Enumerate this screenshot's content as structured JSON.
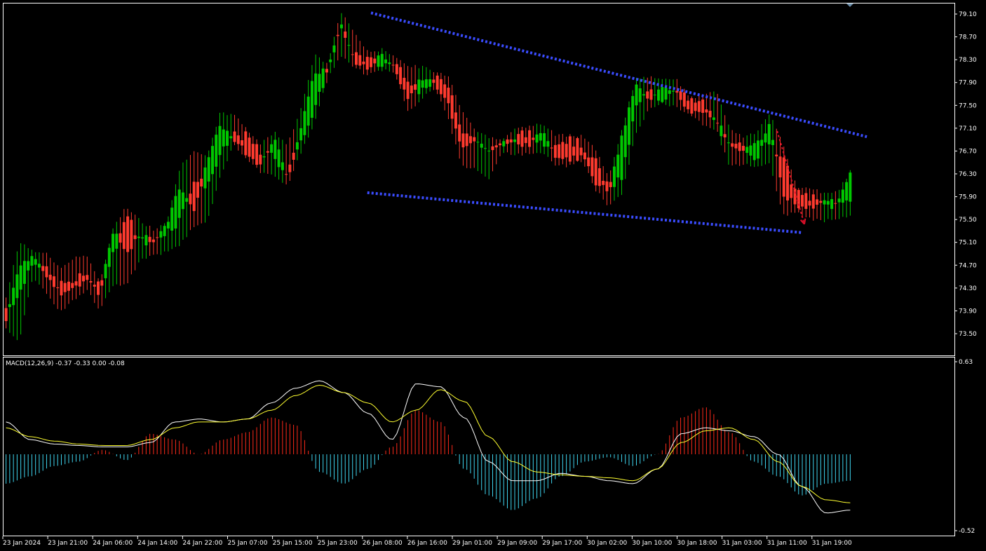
{
  "indicator": {
    "label": "MACD(12,26,9) -0.37 -0.33 0.00 -0.08",
    "params": [
      12,
      26,
      9
    ],
    "values": [
      -0.37,
      -0.33,
      0.0,
      -0.08
    ]
  },
  "colors": {
    "background": "#000000",
    "frame": "#ffffff",
    "bull_candle": "#00c800",
    "bear_candle": "#ff3b2f",
    "trendline": "#3a4cff",
    "forecast_arrow": "#e0102a",
    "macd_hist_pos": "#ff2a1a",
    "macd_hist_neg": "#3fd6f0",
    "macd_line": "#ffffff",
    "signal_line": "#ffff30"
  },
  "chart_data": [
    {
      "type": "candlestick",
      "price_axis_ticks": [
        "79.10",
        "78.70",
        "78.30",
        "77.90",
        "77.50",
        "77.10",
        "76.70",
        "76.30",
        "75.90",
        "75.50",
        "75.10",
        "74.70",
        "74.30",
        "73.90",
        "73.50"
      ],
      "ylim": [
        73.2,
        79.25
      ],
      "time_axis_ticks": [
        "23 Jan 2024",
        "23 Jan 21:00",
        "24 Jan 06:00",
        "24 Jan 14:00",
        "24 Jan 22:00",
        "25 Jan 07:00",
        "25 Jan 15:00",
        "25 Jan 23:00",
        "26 Jan 08:00",
        "26 Jan 16:00",
        "29 Jan 01:00",
        "29 Jan 09:00",
        "29 Jan 17:00",
        "30 Jan 02:00",
        "30 Jan 10:00",
        "30 Jan 18:00",
        "31 Jan 03:00",
        "31 Jan 11:00",
        "31 Jan 19:00"
      ],
      "trendlines": [
        {
          "from": {
            "bar": 99,
            "price": 79.12
          },
          "to": {
            "bar": 224,
            "price": 76.95
          }
        },
        {
          "from": {
            "bar": 98,
            "price": 75.97
          },
          "to": {
            "bar": 216,
            "price": 75.27
          }
        }
      ],
      "forecast_arrow": {
        "from": {
          "bar": 205,
          "price": 77.05
        },
        "to": {
          "bar": 212,
          "price": 75.42
        }
      },
      "ohlc_key_points": [
        [
          73.95,
          74.1,
          73.6,
          73.72
        ],
        [
          74.18,
          75.1,
          73.4,
          74.7
        ],
        [
          74.82,
          74.9,
          74.55,
          74.82
        ],
        [
          74.6,
          74.9,
          74.22,
          74.55
        ],
        [
          74.35,
          74.6,
          73.9,
          74.2
        ],
        [
          74.4,
          74.8,
          74.1,
          74.3
        ],
        [
          74.55,
          74.85,
          74.3,
          74.45
        ],
        [
          74.3,
          74.35,
          73.95,
          74.2
        ],
        [
          74.9,
          75.35,
          74.4,
          75.3
        ],
        [
          75.6,
          75.7,
          74.4,
          74.9
        ],
        [
          75.1,
          75.45,
          74.8,
          75.25
        ],
        [
          75.15,
          75.3,
          74.9,
          75.1
        ],
        [
          75.3,
          75.45,
          74.95,
          75.4
        ],
        [
          75.5,
          76.4,
          75.1,
          76.1
        ],
        [
          76.2,
          76.7,
          75.4,
          75.6
        ],
        [
          76.1,
          76.55,
          75.5,
          76.5
        ],
        [
          76.6,
          77.35,
          76.3,
          77.2
        ],
        [
          77.0,
          77.3,
          76.85,
          76.9
        ],
        [
          76.95,
          77.05,
          76.55,
          76.65
        ],
        [
          76.65,
          76.8,
          76.35,
          76.45
        ],
        [
          76.6,
          77.0,
          76.3,
          76.95
        ],
        [
          76.3,
          76.8,
          76.1,
          76.2
        ],
        [
          76.95,
          77.4,
          76.7,
          77.05
        ],
        [
          77.35,
          78.35,
          77.2,
          78.1
        ],
        [
          78.15,
          78.2,
          78.0,
          78.1
        ],
        [
          78.85,
          79.12,
          78.4,
          78.95
        ],
        [
          78.4,
          78.75,
          78.2,
          78.25
        ],
        [
          78.3,
          78.4,
          78.05,
          78.15
        ],
        [
          78.2,
          78.45,
          78.15,
          78.4
        ],
        [
          78.25,
          78.35,
          78.1,
          78.15
        ],
        [
          78.0,
          78.15,
          77.4,
          77.55
        ],
        [
          77.7,
          78.15,
          77.65,
          78.0
        ],
        [
          77.95,
          78.05,
          77.8,
          77.9
        ],
        [
          77.9,
          78.0,
          77.3,
          77.5
        ],
        [
          77.1,
          77.4,
          76.45,
          76.7
        ],
        [
          76.9,
          77.05,
          76.45,
          76.9
        ],
        [
          76.7,
          76.9,
          76.2,
          76.7
        ],
        [
          76.8,
          76.9,
          76.7,
          76.85
        ],
        [
          76.95,
          77.05,
          76.65,
          76.85
        ],
        [
          77.0,
          77.1,
          76.7,
          76.8
        ],
        [
          76.85,
          77.15,
          76.7,
          77.05
        ],
        [
          76.85,
          76.95,
          76.5,
          76.55
        ],
        [
          76.9,
          76.95,
          76.45,
          76.55
        ],
        [
          76.8,
          76.95,
          76.55,
          76.6
        ],
        [
          76.5,
          76.7,
          76.05,
          76.15
        ],
        [
          76.05,
          76.2,
          75.75,
          76.0
        ],
        [
          76.25,
          77.1,
          76.0,
          77.0
        ],
        [
          77.45,
          77.95,
          77.05,
          77.9
        ],
        [
          77.75,
          77.95,
          77.45,
          77.6
        ],
        [
          77.6,
          77.95,
          77.55,
          77.8
        ],
        [
          77.85,
          77.95,
          77.5,
          77.7
        ],
        [
          77.55,
          77.6,
          77.35,
          77.4
        ],
        [
          77.55,
          77.65,
          77.2,
          77.4
        ],
        [
          77.2,
          77.7,
          77.1,
          77.25
        ],
        [
          76.75,
          77.1,
          76.45,
          76.85
        ],
        [
          76.8,
          76.9,
          76.5,
          76.7
        ],
        [
          76.6,
          77.0,
          76.45,
          76.8
        ],
        [
          76.9,
          77.35,
          76.5,
          77.15
        ],
        [
          76.55,
          76.8,
          75.6,
          75.95
        ],
        [
          75.95,
          76.05,
          75.65,
          75.75
        ],
        [
          75.9,
          76.0,
          75.55,
          75.7
        ],
        [
          75.75,
          75.95,
          75.5,
          75.85
        ],
        [
          75.75,
          75.95,
          75.55,
          75.8
        ],
        [
          75.85,
          76.3,
          75.6,
          76.3
        ]
      ]
    },
    {
      "type": "bar+line",
      "name": "MACD(12,26,9)",
      "axis_ticks": [
        "0.63",
        "-0.52"
      ],
      "ylim": [
        -0.52,
        0.63
      ],
      "histogram_key_points": [
        -0.2,
        -0.15,
        -0.08,
        -0.05,
        0.03,
        -0.04,
        0.14,
        0.1,
        0.0,
        0.1,
        0.15,
        0.25,
        0.2,
        -0.12,
        -0.2,
        -0.1,
        0.05,
        0.3,
        0.22,
        -0.1,
        -0.28,
        -0.38,
        -0.3,
        -0.15,
        -0.05,
        -0.02,
        -0.08,
        0.0,
        0.25,
        0.32,
        0.15,
        -0.05,
        -0.15,
        -0.28,
        -0.2,
        -0.18
      ],
      "macd_line_key_points": [
        0.22,
        0.1,
        0.07,
        0.06,
        0.05,
        0.05,
        0.08,
        0.22,
        0.24,
        0.22,
        0.24,
        0.35,
        0.45,
        0.5,
        0.42,
        0.28,
        0.1,
        0.48,
        0.46,
        0.25,
        -0.05,
        -0.18,
        -0.18,
        -0.13,
        -0.15,
        -0.18,
        -0.2,
        -0.1,
        0.14,
        0.18,
        0.16,
        0.12,
        0.0,
        -0.22,
        -0.4,
        -0.38
      ],
      "signal_line_key_points": [
        0.18,
        0.12,
        0.09,
        0.07,
        0.06,
        0.06,
        0.1,
        0.18,
        0.22,
        0.22,
        0.24,
        0.3,
        0.4,
        0.47,
        0.42,
        0.35,
        0.22,
        0.3,
        0.44,
        0.36,
        0.12,
        -0.05,
        -0.12,
        -0.14,
        -0.15,
        -0.16,
        -0.18,
        -0.1,
        0.08,
        0.16,
        0.18,
        0.1,
        -0.05,
        -0.22,
        -0.31,
        -0.33
      ]
    }
  ]
}
